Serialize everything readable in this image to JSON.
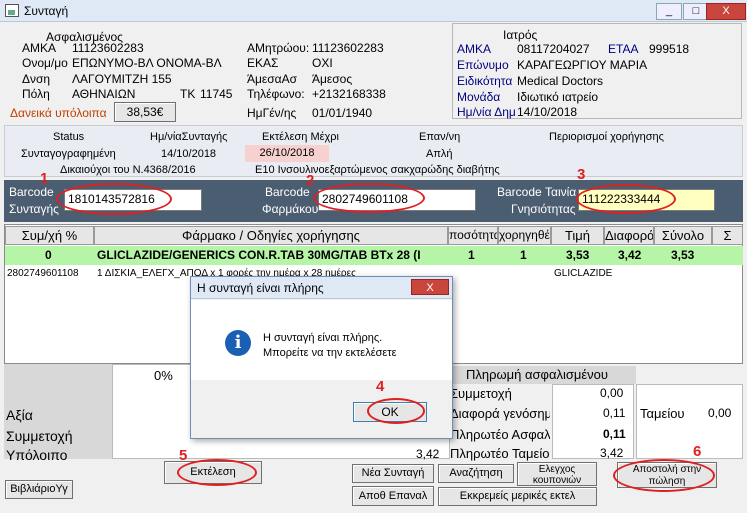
{
  "window": {
    "title": "Συνταγή",
    "min": "_",
    "max": "□",
    "close": "X"
  },
  "insured": {
    "heading": "Ασφαλισμένος",
    "amka_label": "ΑΜΚΑ",
    "amka": "11123602283",
    "name_label": "Ονομ/μο",
    "name": "ΕΠΩΝΥΜΟ-ΒΛ ΟΝΟΜΑ-ΒΛ",
    "addr_label": "Δνση",
    "addr": "ΛΑΓΟΥΜΙΤΖΗ 155",
    "city_label": "Πόλη",
    "city": "ΑΘΗΝΑΙΩΝ",
    "tk_label": "ΤΚ",
    "tk": "11745",
    "loan_label": "Δανεικά υπόλοιπα",
    "loan": "38,53€",
    "regno_label": "ΑΜητρώου:",
    "regno": "11123602283",
    "ekas_label": "ΕΚΑΣ",
    "ekas": "ΟΧΙ",
    "direct_label": "ΆμεσαΑσ",
    "direct": "Άμεσος",
    "phone_label": "Τηλέφωνο:",
    "phone": "+2132168338",
    "dob_label": "ΗμΓέν/ης",
    "dob": "01/01/1940"
  },
  "doctor": {
    "heading": "Ιατρός",
    "amka_label": "ΑΜΚΑ",
    "amka": "08117204027",
    "etaa_label": "ΕΤΑΑ",
    "etaa": "999518",
    "surname_label": "Επώνυμο",
    "surname": "ΚΑΡΑΓΕΩΡΓΙΟΥ ΜΑΡΙΑ",
    "spec_label": "Ειδικότητα",
    "spec": "Medical Doctors",
    "unit_label": "Μονάδα",
    "unit": "Ιδιωτικό ιατρείο",
    "date_label": "Ημ/νία Δημ",
    "date": "14/10/2018"
  },
  "status": {
    "status_h": "Status",
    "date_h": "Ημ/νίαΣυνταγής",
    "exec_h": "Εκτέλεση Μέχρι",
    "rep_h": "Επαν/νη",
    "limits_h": "Περιορισμοί χορήγησης",
    "status": "Συνταγογραφημένη",
    "date": "14/10/2018",
    "exec": "26/10/2018",
    "rep": "Απλή",
    "note1": "Δικαιούχοι του Ν.4368/2016",
    "note2": "Ε10 Ινσουλινοεξαρτώμενος σακχαρώδης διαβήτης"
  },
  "barcodes": {
    "rx_label1": "Barcode",
    "rx_label2": "Συνταγής",
    "rx": "1810143572816",
    "drug_label1": "Barcode",
    "drug_label2": "Φαρμάκου",
    "drug": "2802749601108",
    "tape_label1": "Barcode Ταινία",
    "tape_label2": "Γνησιότητας",
    "tape": "111222333444"
  },
  "grid": {
    "headers": [
      "Συμ/χή %",
      "Φάρμακο / Οδηγίες χορήγησης",
      "ποσότητα",
      "χορηγηθέν",
      "Τιμή",
      "Διαφορά",
      "Σύνολο",
      "Σ"
    ],
    "row1": [
      "0",
      "GLICLAZIDE/GENERICS CON.R.TAB 30MG/TAB BTx 28 (I",
      "1",
      "1",
      "3,53",
      "3,42",
      "3,53"
    ],
    "row2_code": "2802749601108",
    "row2_text": "1 ΔΙΣΚΙΑ_ΕΛΕΓΧ_ΑΠΟΔ x 1 φορές την ημέρα x 28 ημέρες",
    "row2_name": "GLICLAZIDE"
  },
  "totals": {
    "pct": "0%",
    "row_labels": [
      "Αξία",
      "Συμμετοχή",
      "Υπόλοιπο"
    ],
    "left_vals": [
      "",
      "",
      "3,42"
    ],
    "insured_h": "Πληρωμή ασφαλισμένου",
    "r_labels": [
      "Συμμετοχή",
      "Διαφορά γενόσημ",
      "Πληρωτέο Ασφαλ",
      "Πληρωτέο Ταμείου"
    ],
    "r_vals": [
      "0,00",
      "0,11",
      "0,11",
      "3,42"
    ],
    "cash_label": "Ταμείου",
    "cash": "0,00"
  },
  "buttons": {
    "passbook": "ΒιβλιάριοΥγ",
    "execute": "Εκτέλεση",
    "new": "Νέα Συνταγή",
    "search": "Αναζήτηση",
    "coupons": "Ελεγχος κουπονιών",
    "save": "Αποθ Επαναλ",
    "pending": "Εκκρεμείς μερικές εκτελ",
    "send": "Αποστολή στην πώληση"
  },
  "dialog": {
    "title": "Η συνταγή είναι πλήρης",
    "line1": "Η συνταγή είναι πλήρης.",
    "line2": "Μπορείτε να την εκτελέσετε",
    "ok": "OK",
    "close": "X"
  },
  "markers": [
    "1",
    "2",
    "3",
    "4",
    "5",
    "6"
  ],
  "colors": {
    "accent_green": "#b6f5a8",
    "annotation_red": "#e02020",
    "tape_yellow": "#ffffc0",
    "dark_band": "#4b5d70"
  }
}
